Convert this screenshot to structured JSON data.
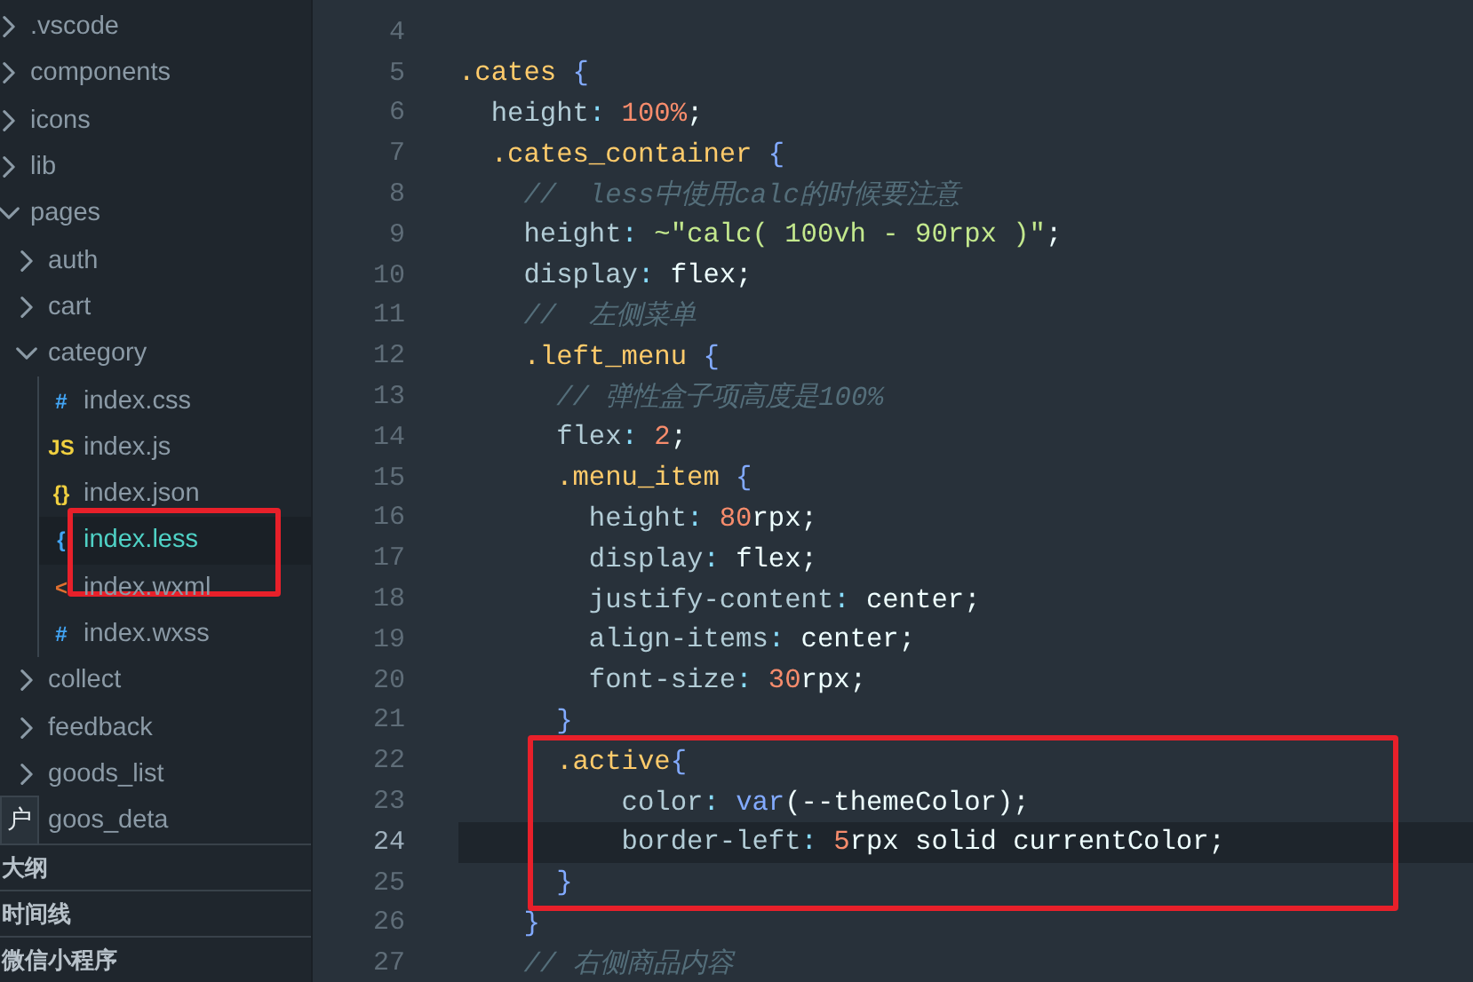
{
  "explorer": {
    "tree": [
      {
        "label": ".vscode",
        "expanded": false
      },
      {
        "label": "components",
        "expanded": false
      },
      {
        "label": "icons",
        "expanded": false
      },
      {
        "label": "lib",
        "expanded": false
      },
      {
        "label": "pages",
        "expanded": true,
        "children": [
          {
            "label": "auth",
            "expanded": false
          },
          {
            "label": "cart",
            "expanded": false
          },
          {
            "label": "category",
            "expanded": true,
            "children": [
              {
                "label": "index.css",
                "kind": "css",
                "icon": "#",
                "selected": false,
                "boxed": false
              },
              {
                "label": "index.js",
                "kind": "js",
                "icon": "JS",
                "selected": false,
                "boxed": false
              },
              {
                "label": "index.json",
                "kind": "json",
                "icon": "{}",
                "selected": false,
                "boxed": false
              },
              {
                "label": "index.less",
                "kind": "less",
                "icon": "{",
                "selected": true,
                "boxed": true
              },
              {
                "label": "index.wxml",
                "kind": "wxml",
                "icon": "<",
                "selected": false,
                "boxed": false
              },
              {
                "label": "index.wxss",
                "kind": "wxss",
                "icon": "#",
                "selected": false,
                "boxed": false
              }
            ]
          },
          {
            "label": "collect",
            "expanded": false
          },
          {
            "label": "feedback",
            "expanded": false
          },
          {
            "label": "goods_list",
            "expanded": false
          },
          {
            "label": "goos_deta",
            "expanded": false
          }
        ]
      }
    ],
    "tooltip": "户",
    "panels": [
      "大纲",
      "时间线",
      "微信小程序"
    ]
  },
  "editor": {
    "lines": [
      {
        "number": "4",
        "current": false,
        "boxed": false
      },
      {
        "number": "5",
        "current": false,
        "boxed": false,
        "tokens": [
          {
            "kind": "sel",
            "text": ".cates"
          },
          {
            "kind": "brace",
            "text": " {"
          }
        ]
      },
      {
        "number": "6",
        "current": false,
        "boxed": false,
        "tokens": [
          {
            "kind": "prop",
            "text": "  height"
          },
          {
            "kind": "punct",
            "text": ": "
          },
          {
            "kind": "num",
            "text": "100%"
          },
          {
            "kind": "val",
            "text": ";"
          }
        ]
      },
      {
        "number": "7",
        "current": false,
        "boxed": false,
        "tokens": [
          {
            "kind": "sel",
            "text": "  .cates_container"
          },
          {
            "kind": "brace",
            "text": " {"
          }
        ]
      },
      {
        "number": "8",
        "current": false,
        "boxed": false,
        "tokens": [
          {
            "kind": "cmt",
            "text": "    //  less中使用calc的时候要注意"
          }
        ]
      },
      {
        "number": "9",
        "current": false,
        "boxed": false,
        "tokens": [
          {
            "kind": "prop",
            "text": "    height"
          },
          {
            "kind": "punct",
            "text": ": "
          },
          {
            "kind": "str",
            "text": "~\"calc( 100vh - 90rpx )\""
          },
          {
            "kind": "val",
            "text": ";"
          }
        ]
      },
      {
        "number": "10",
        "current": false,
        "boxed": false,
        "tokens": [
          {
            "kind": "prop",
            "text": "    display"
          },
          {
            "kind": "punct",
            "text": ": "
          },
          {
            "kind": "val",
            "text": "flex;"
          }
        ]
      },
      {
        "number": "11",
        "current": false,
        "boxed": false,
        "tokens": [
          {
            "kind": "cmt",
            "text": "    //  左侧菜单"
          }
        ]
      },
      {
        "number": "12",
        "current": false,
        "boxed": false,
        "tokens": [
          {
            "kind": "sel",
            "text": "    .left_menu"
          },
          {
            "kind": "brace",
            "text": " {"
          }
        ]
      },
      {
        "number": "13",
        "current": false,
        "boxed": false,
        "tokens": [
          {
            "kind": "cmt",
            "text": "      // 弹性盒子项高度是100%"
          }
        ]
      },
      {
        "number": "14",
        "current": false,
        "boxed": false,
        "tokens": [
          {
            "kind": "prop",
            "text": "      flex"
          },
          {
            "kind": "punct",
            "text": ": "
          },
          {
            "kind": "num",
            "text": "2"
          },
          {
            "kind": "val",
            "text": ";"
          }
        ]
      },
      {
        "number": "15",
        "current": false,
        "boxed": false,
        "tokens": [
          {
            "kind": "sel",
            "text": "      .menu_item"
          },
          {
            "kind": "brace",
            "text": " {"
          }
        ]
      },
      {
        "number": "16",
        "current": false,
        "boxed": false,
        "tokens": [
          {
            "kind": "prop",
            "text": "        height"
          },
          {
            "kind": "punct",
            "text": ": "
          },
          {
            "kind": "num",
            "text": "80"
          },
          {
            "kind": "val",
            "text": "rpx;"
          }
        ]
      },
      {
        "number": "17",
        "current": false,
        "boxed": false,
        "tokens": [
          {
            "kind": "prop",
            "text": "        display"
          },
          {
            "kind": "punct",
            "text": ": "
          },
          {
            "kind": "val",
            "text": "flex;"
          }
        ]
      },
      {
        "number": "18",
        "current": false,
        "boxed": false,
        "tokens": [
          {
            "kind": "prop",
            "text": "        justify-content"
          },
          {
            "kind": "punct",
            "text": ": "
          },
          {
            "kind": "val",
            "text": "center;"
          }
        ]
      },
      {
        "number": "19",
        "current": false,
        "boxed": false,
        "tokens": [
          {
            "kind": "prop",
            "text": "        align-items"
          },
          {
            "kind": "punct",
            "text": ": "
          },
          {
            "kind": "val",
            "text": "center;"
          }
        ]
      },
      {
        "number": "20",
        "current": false,
        "boxed": false,
        "tokens": [
          {
            "kind": "prop",
            "text": "        font-size"
          },
          {
            "kind": "punct",
            "text": ": "
          },
          {
            "kind": "num",
            "text": "30"
          },
          {
            "kind": "val",
            "text": "rpx;"
          }
        ]
      },
      {
        "number": "21",
        "current": false,
        "boxed": false,
        "tokens": [
          {
            "kind": "brace",
            "text": "      }"
          }
        ]
      },
      {
        "number": "22",
        "current": false,
        "boxed": true,
        "tokens": [
          {
            "kind": "sel",
            "text": "      .active"
          },
          {
            "kind": "brace",
            "text": "{"
          }
        ]
      },
      {
        "number": "23",
        "current": false,
        "boxed": true,
        "tokens": [
          {
            "kind": "prop",
            "text": "          color"
          },
          {
            "kind": "punct",
            "text": ": "
          },
          {
            "kind": "fn",
            "text": "var"
          },
          {
            "kind": "val",
            "text": "(--themeColor);"
          }
        ]
      },
      {
        "number": "24",
        "current": true,
        "boxed": true,
        "tokens": [
          {
            "kind": "prop",
            "text": "          border-left"
          },
          {
            "kind": "punct",
            "text": ": "
          },
          {
            "kind": "num",
            "text": "5"
          },
          {
            "kind": "val",
            "text": "rpx solid currentColor;"
          }
        ]
      },
      {
        "number": "25",
        "current": false,
        "boxed": true,
        "tokens": [
          {
            "kind": "brace",
            "text": "      }"
          }
        ]
      },
      {
        "number": "26",
        "current": false,
        "boxed": false,
        "tokens": [
          {
            "kind": "brace",
            "text": "    }"
          }
        ]
      },
      {
        "number": "27",
        "current": false,
        "boxed": false,
        "tokens": [
          {
            "kind": "cmt",
            "text": "    // 右侧商品内容"
          }
        ]
      }
    ]
  }
}
